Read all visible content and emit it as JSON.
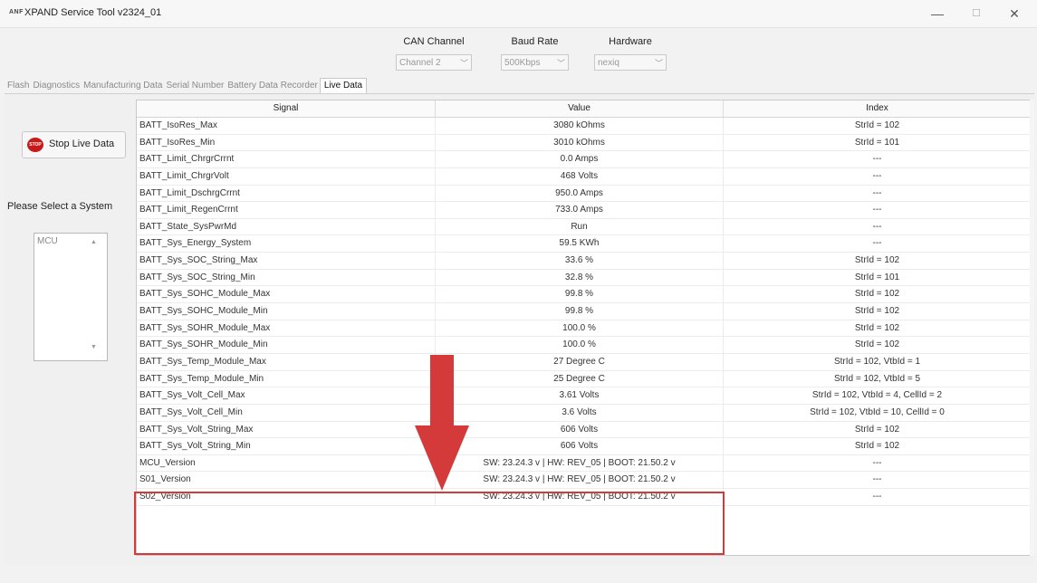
{
  "window": {
    "logo_text": "ANF",
    "title": "XPAND Service Tool v2324_01",
    "minimize": "—",
    "maximize": "☐",
    "close": "✕"
  },
  "connection": {
    "can_channel_label": "CAN Channel",
    "can_channel_value": "Channel 2",
    "baud_rate_label": "Baud Rate",
    "baud_rate_value": "500Kbps",
    "hardware_label": "Hardware",
    "hardware_value": "nexiq"
  },
  "tabs": [
    "Flash",
    "Diagnostics",
    "Manufacturing Data",
    "Serial Number",
    "Battery Data Recorder",
    "Live Data"
  ],
  "active_tab": "Live Data",
  "sidebar": {
    "stop_icon_text": "STOP",
    "stop_button_label": "Stop Live Data",
    "select_label": "Please Select a System",
    "systems": [
      "MCU"
    ]
  },
  "table": {
    "columns": [
      "Signal",
      "Value",
      "Index"
    ],
    "rows": [
      [
        "BATT_IsoRes_Max",
        "3080 kOhms",
        "StrId = 102"
      ],
      [
        "BATT_IsoRes_Min",
        "3010 kOhms",
        "StrId = 101"
      ],
      [
        "BATT_Limit_ChrgrCrrnt",
        "0.0 Amps",
        "---"
      ],
      [
        "BATT_Limit_ChrgrVolt",
        "468 Volts",
        "---"
      ],
      [
        "BATT_Limit_DschrgCrrnt",
        "950.0 Amps",
        "---"
      ],
      [
        "BATT_Limit_RegenCrrnt",
        "733.0 Amps",
        "---"
      ],
      [
        "BATT_State_SysPwrMd",
        "Run",
        "---"
      ],
      [
        "BATT_Sys_Energy_System",
        "59.5 KWh",
        "---"
      ],
      [
        "BATT_Sys_SOC_String_Max",
        "33.6 %",
        "StrId = 102"
      ],
      [
        "BATT_Sys_SOC_String_Min",
        "32.8 %",
        "StrId = 101"
      ],
      [
        "BATT_Sys_SOHC_Module_Max",
        "99.8 %",
        "StrId = 102"
      ],
      [
        "BATT_Sys_SOHC_Module_Min",
        "99.8 %",
        "StrId = 102"
      ],
      [
        "BATT_Sys_SOHR_Module_Max",
        "100.0 %",
        "StrId = 102"
      ],
      [
        "BATT_Sys_SOHR_Module_Min",
        "100.0 %",
        "StrId = 102"
      ],
      [
        "BATT_Sys_Temp_Module_Max",
        "27 Degree C",
        "StrId = 102, VtbId = 1"
      ],
      [
        "BATT_Sys_Temp_Module_Min",
        "25 Degree C",
        "StrId = 102, VtbId = 5"
      ],
      [
        "BATT_Sys_Volt_Cell_Max",
        "3.61 Volts",
        "StrId = 102, VtbId = 4, CellId = 2"
      ],
      [
        "BATT_Sys_Volt_Cell_Min",
        "3.6 Volts",
        "StrId = 102, VtbId = 10, CellId = 0"
      ],
      [
        "BATT_Sys_Volt_String_Max",
        "606 Volts",
        "StrId = 102"
      ],
      [
        "BATT_Sys_Volt_String_Min",
        "606 Volts",
        "StrId = 102"
      ],
      [
        "MCU_Version",
        "SW: 23.24.3  v | HW: REV_05 | BOOT: 21.50.2 v",
        "---"
      ],
      [
        "S01_Version",
        "SW: 23.24.3  v | HW: REV_05 | BOOT: 21.50.2 v",
        "---"
      ],
      [
        "S02_Version",
        "SW: 23.24.3  v | HW: REV_05 | BOOT: 21.50.2 v",
        "---"
      ]
    ]
  },
  "annotation": {
    "color": "#d43a3a"
  }
}
